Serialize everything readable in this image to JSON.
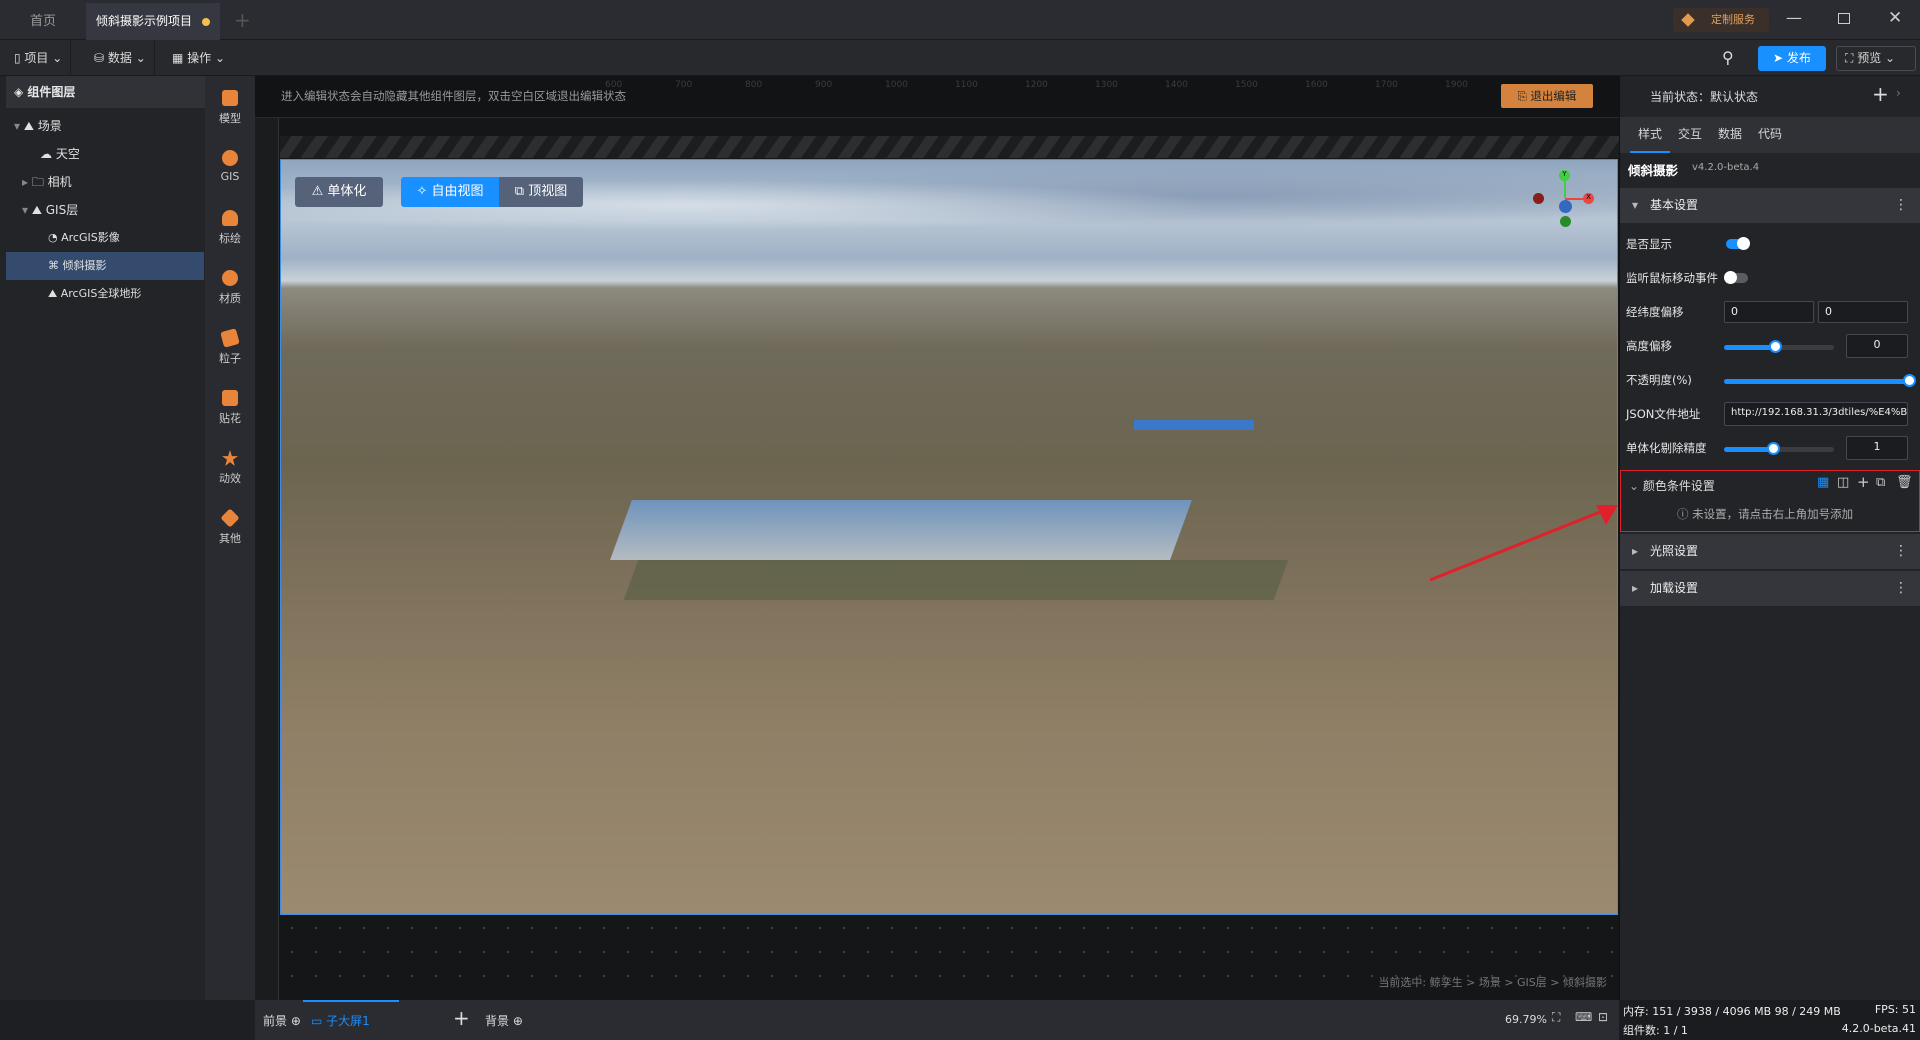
{
  "tabs": [
    {
      "label": "首页"
    },
    {
      "label": "倾斜摄影示例项目"
    }
  ],
  "titlebar": {
    "custom_service": "定制服务"
  },
  "toolbar": {
    "project": "项目",
    "data": "数据",
    "operate": "操作",
    "publish": "发布",
    "preview": "预览"
  },
  "left": {
    "title": "组件图层",
    "tree": [
      "场景",
      "天空",
      "相机",
      "GIS层",
      "ArcGIS影像",
      "倾斜摄影",
      "ArcGIS全球地形"
    ]
  },
  "components": [
    "模型",
    "GIS",
    "标绘",
    "材质",
    "粒子",
    "贴花",
    "动效",
    "其他"
  ],
  "canvas": {
    "hint": "进入编辑状态会自动隐藏其他组件图层，双击空白区域退出编辑状态",
    "exit_edit": "退出编辑",
    "ruler_ticks": [
      "600",
      "700",
      "800",
      "900",
      "1000",
      "1100",
      "1200",
      "1300",
      "1400",
      "1500",
      "1600",
      "1700",
      "1900"
    ],
    "view_buttons": {
      "single": "单体化",
      "free": "自由视图",
      "top": "顶视图"
    },
    "axes": {
      "x": "X",
      "y": "Y"
    },
    "selected_path": "当前选中: 鲸孪生 > 场景 > GIS层 > 倾斜摄影"
  },
  "bottom": {
    "front": "前景",
    "screen": "子大屏1",
    "back": "背景",
    "zoom": "69.79%"
  },
  "right": {
    "state": "当前状态：默认状态",
    "tabs": [
      "样式",
      "交互",
      "数据",
      "代码"
    ],
    "component": "倾斜摄影",
    "version": "v4.2.0-beta.4",
    "basic": "基本设置",
    "rows": {
      "show": "是否显示",
      "mouse": "监听鼠标移动事件",
      "lnglat": "经纬度偏移",
      "lng": "0",
      "lat": "0",
      "height": "高度偏移",
      "height_val": "0",
      "height_pct": 47,
      "opacity": "不透明度(%)",
      "opacity_pct": 100,
      "json": "JSON文件地址",
      "json_val": "http://192.168.31.3/3dtiles/%E4%B",
      "cull": "单体化剔除精度",
      "cull_val": "1",
      "cull_pct": 45
    },
    "color_cond": "颜色条件设置",
    "color_empty": "未设置，请点击右上角加号添加",
    "light": "光照设置",
    "load": "加载设置"
  },
  "status": {
    "memory": "内存: 151 / 3938 / 4096 MB  98 / 249 MB",
    "fps": "FPS: 51",
    "count": "组件数: 1 / 1",
    "version": "4.2.0-beta.41"
  }
}
